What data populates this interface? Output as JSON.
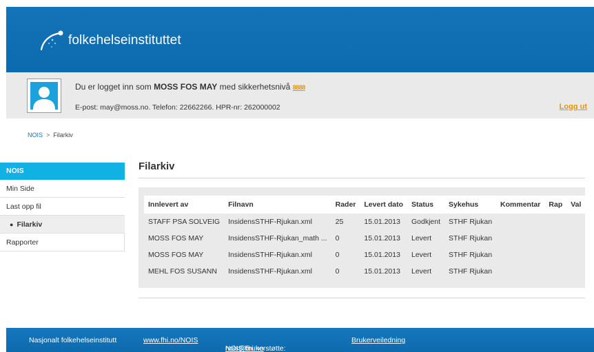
{
  "header": {
    "logo_text": "folkehelseinstituttet"
  },
  "user": {
    "login_prefix": "Du er logget inn som ",
    "name": "MOSS FOS MAY",
    "login_mid": " med sikkerhetsnivå ",
    "level": "8888",
    "contact": "E-post: may@moss.no.   Telefon: 22662266.   HPR-nr: 262000002",
    "logout_label": "Logg ut"
  },
  "breadcrumb": {
    "root": "NOIS",
    "sep": ">",
    "current": "Filarkiv"
  },
  "sidebar": {
    "heading": "NOIS",
    "items": [
      {
        "label": "Min Side"
      },
      {
        "label": "Last opp fil"
      },
      {
        "label": "Filarkiv",
        "bullet": "●"
      },
      {
        "label": "Rapporter"
      }
    ]
  },
  "main": {
    "title": "Filarkiv",
    "table": {
      "headers": [
        "Innlevert av",
        "Filnavn",
        "Rader",
        "Levert dato",
        "Status",
        "Sykehus",
        "Kommentar",
        "Rap",
        "Val"
      ],
      "rows": [
        [
          "STAFF PSA SOLVEIG",
          "InsidensSTHF-Rjukan.xml",
          "25",
          "15.01.2013",
          "Godkjent",
          "STHF Rjukan",
          "",
          "",
          ""
        ],
        [
          "MOSS FOS MAY",
          "InsidensSTHF-Rjukan_math ...",
          "0",
          "15.01.2013",
          "Levert",
          "STHF Rjukan",
          "",
          "",
          ""
        ],
        [
          "MOSS FOS MAY",
          "InsidensSTHF-Rjukan.xml",
          "0",
          "15.01.2013",
          "Levert",
          "STHF Rjukan",
          "",
          "",
          ""
        ],
        [
          "MEHL FOS SUSANN",
          "InsidensSTHF-Rjukan.xml",
          "0",
          "15.01.2013",
          "Levert",
          "STHF Rjukan",
          "",
          "",
          ""
        ]
      ]
    }
  },
  "footer": {
    "org": "Nasjonalt folkehelseinstitutt",
    "link1": "www.fhi.no/NOIS",
    "support_label": "NOIS brukerstøtte: ",
    "support_email": "nois@fhi.no",
    "guide": "Brukerveiledning"
  },
  "colors": {
    "brand_blue": "#1474b8",
    "nav_cyan": "#10b1e3",
    "accent_orange": "#e8930c"
  }
}
